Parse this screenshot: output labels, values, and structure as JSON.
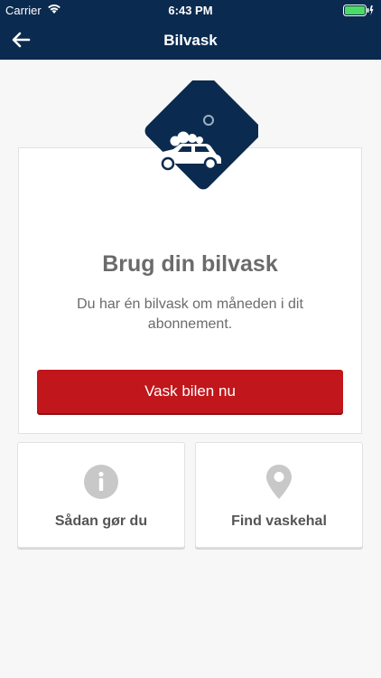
{
  "status_bar": {
    "carrier": "Carrier",
    "time": "6:43 PM"
  },
  "header": {
    "title": "Bilvask",
    "back_icon": "arrow-left-icon"
  },
  "card": {
    "illustration_icon": "car-wash-icon",
    "headline": "Brug din bilvask",
    "description": "Du har én bilvask om måneden i dit abonnement.",
    "button_label": "Vask bilen nu"
  },
  "tiles": [
    {
      "icon": "info-icon",
      "label": "Sådan gør du"
    },
    {
      "icon": "location-pin-icon",
      "label": "Find vaskehal"
    }
  ],
  "colors": {
    "header_bg": "#0b2a4f",
    "primary_button": "#c0161c",
    "battery": "#4cd964",
    "icon_gray": "#c8c8c8",
    "text_gray": "#6b6b6b"
  }
}
